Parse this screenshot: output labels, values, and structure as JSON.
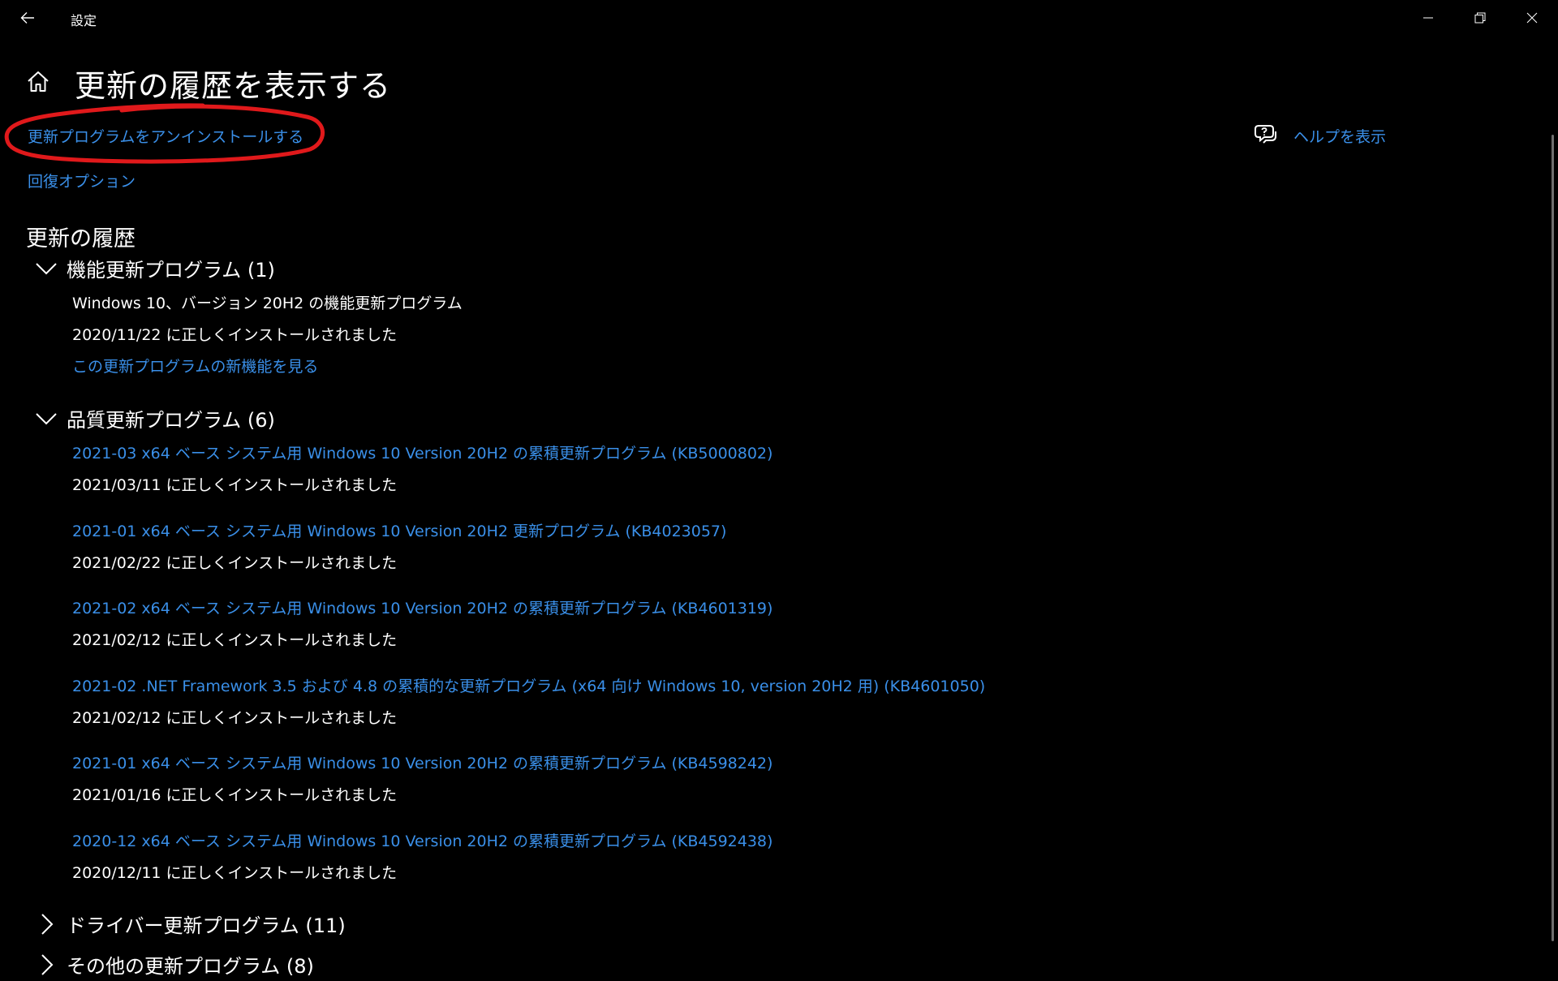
{
  "window": {
    "title": "設定",
    "back_icon": "back-arrow-icon",
    "minimize_icon": "minimize-icon",
    "maximize_icon": "restore-icon",
    "close_icon": "close-icon"
  },
  "header": {
    "title": "更新の履歴を表示する",
    "home_icon": "home-icon"
  },
  "links": {
    "uninstall": "更新プログラムをアンインストールする",
    "recovery": "回復オプション",
    "help": "ヘルプを表示",
    "help_icon": "help-chat-icon"
  },
  "annotation": {
    "circle_color": "#e0191b"
  },
  "section": {
    "title": "更新の履歴"
  },
  "groups": {
    "feature": {
      "title": "機能更新プログラム (1)",
      "expanded": true,
      "items": [
        {
          "name": "Windows 10、バージョン 20H2 の機能更新プログラム",
          "status": "2020/11/22 に正しくインストールされました",
          "link": "この更新プログラムの新機能を見る"
        }
      ]
    },
    "quality": {
      "title": "品質更新プログラム (6)",
      "expanded": true,
      "items": [
        {
          "name": "2021-03 x64 ベース システム用 Windows 10 Version 20H2 の累積更新プログラム (KB5000802)",
          "status": "2021/03/11 に正しくインストールされました"
        },
        {
          "name": "2021-01 x64 ベース システム用 Windows 10 Version 20H2 更新プログラム (KB4023057)",
          "status": "2021/02/22 に正しくインストールされました"
        },
        {
          "name": "2021-02 x64 ベース システム用 Windows 10 Version 20H2 の累積更新プログラム (KB4601319)",
          "status": "2021/02/12 に正しくインストールされました"
        },
        {
          "name": "2021-02 .NET Framework 3.5 および 4.8 の累積的な更新プログラム (x64 向け Windows 10, version 20H2 用) (KB4601050)",
          "status": "2021/02/12 に正しくインストールされました"
        },
        {
          "name": "2021-01 x64 ベース システム用 Windows 10 Version 20H2 の累積更新プログラム (KB4598242)",
          "status": "2021/01/16 に正しくインストールされました"
        },
        {
          "name": "2020-12 x64 ベース システム用 Windows 10 Version 20H2 の累積更新プログラム (KB4592438)",
          "status": "2020/12/11 に正しくインストールされました"
        }
      ]
    },
    "driver": {
      "title": "ドライバー更新プログラム (11)",
      "expanded": false
    },
    "other": {
      "title": "その他の更新プログラム (8)",
      "expanded": false
    }
  },
  "colors": {
    "background": "#000000",
    "text": "#ffffff",
    "link": "#3a8fe8"
  }
}
